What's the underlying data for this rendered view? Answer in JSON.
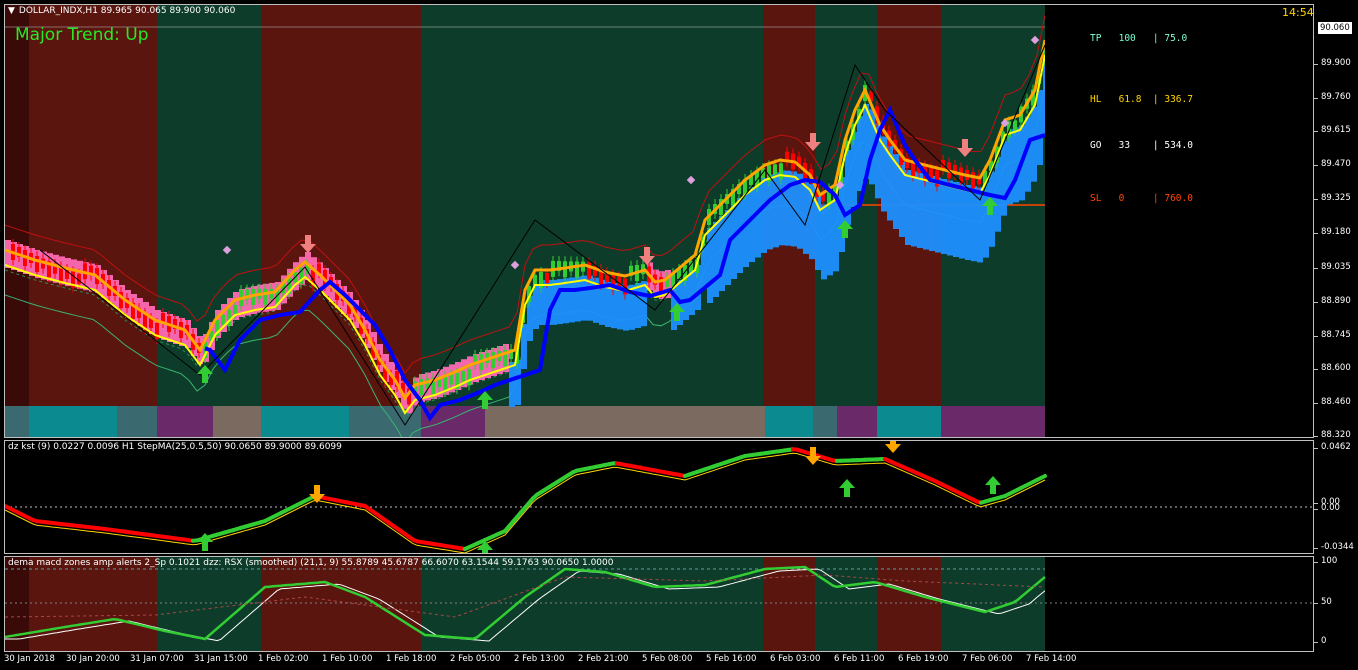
{
  "chart": {
    "symbol_header": "DOLLAR_INDX,H1  89.965 90.065 89.900 90.060",
    "trend_label": "Major Trend: Up",
    "clock": "14:54",
    "current_price": "90.060",
    "price_ticks": [
      "89.900",
      "89.760",
      "89.615",
      "89.470",
      "89.325",
      "89.180",
      "89.035",
      "88.890",
      "88.745",
      "88.600",
      "88.460",
      "88.320"
    ],
    "levels": [
      {
        "label": "TP   100   | 75.0",
        "color": "#7fffd4"
      },
      {
        "label": "HL   61.8  | 336.7",
        "color": "#ffd700"
      },
      {
        "label": "GO   33    | 534.0",
        "color": "#ffffff"
      },
      {
        "label": "SL   0     | 760.0",
        "color": "#ff4500"
      }
    ],
    "colors": {
      "bull": "#32cd32",
      "bear": "#ff0000",
      "blue_ma": "#0000ff",
      "orange_ma": "#ffa500",
      "cloud_up": "#1e90ff",
      "cloud_down": "#ff69b4"
    }
  },
  "indicator1": {
    "title": "dz kst (9) 0.0227 0.0096   H1 StepMA(25,0.5,50) 90.0650 89.9000 89.6099",
    "ticks": [
      "0.0462",
      "0.00",
      "0.00",
      "-0.0344"
    ]
  },
  "indicator2": {
    "title": "dema macd zones amp alerts 2_Sp 0.1021  dzz:  RSX (smoothed) (21,1, 9) 55.8789 45.6787 66.6070 63.1544 59.1763 90.0650 1.0000",
    "ticks": [
      "100",
      "50",
      "0"
    ]
  },
  "time_axis": [
    "30 Jan 2018",
    "30 Jan 20:00",
    "31 Jan 07:00",
    "31 Jan 15:00",
    "1 Feb 02:00",
    "1 Feb 10:00",
    "1 Feb 18:00",
    "2 Feb 05:00",
    "2 Feb 13:00",
    "2 Feb 21:00",
    "5 Feb 08:00",
    "5 Feb 16:00",
    "6 Feb 03:00",
    "6 Feb 11:00",
    "6 Feb 19:00",
    "7 Feb 06:00",
    "7 Feb 14:00"
  ]
}
